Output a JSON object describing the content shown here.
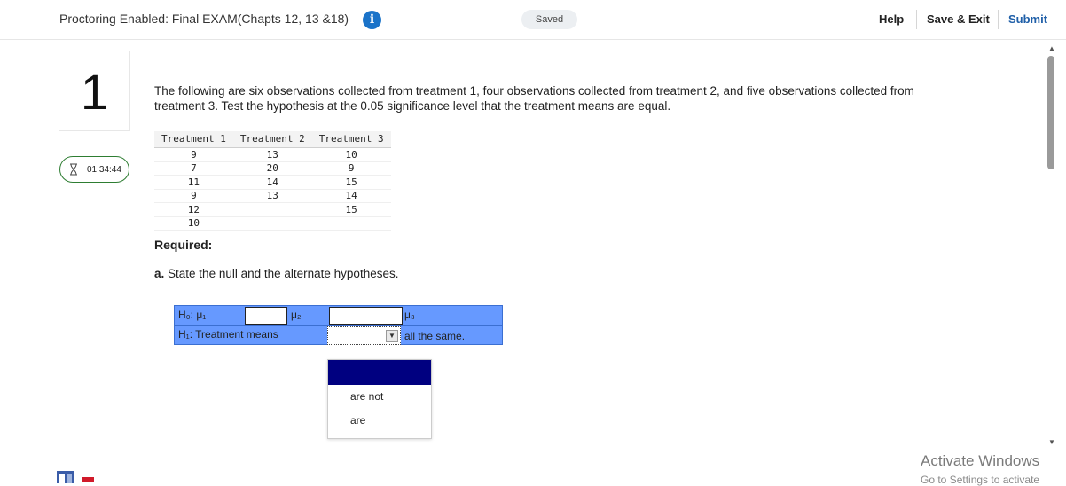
{
  "header": {
    "exam_title": "Proctoring Enabled: Final EXAM(Chapts 12, 13 &18)",
    "saved_label": "Saved",
    "help_label": "Help",
    "save_exit_label": "Save & Exit",
    "submit_label": "Submit"
  },
  "question": {
    "number": "1",
    "timer": "01:34:44",
    "text": "The following are six observations collected from treatment 1, four observations collected from treatment 2, and five observations collected from treatment 3. Test the hypothesis at the 0.05 significance level that the treatment means are equal."
  },
  "table": {
    "headers": [
      "Treatment 1",
      "Treatment 2",
      "Treatment 3"
    ],
    "rows": [
      [
        "9",
        "13",
        "10"
      ],
      [
        "7",
        "20",
        "9"
      ],
      [
        "11",
        "14",
        "15"
      ],
      [
        "9",
        "13",
        "14"
      ],
      [
        "12",
        "",
        "15"
      ],
      [
        "10",
        "",
        ""
      ]
    ]
  },
  "required": {
    "label": "Required:",
    "part_a_letter": "a.",
    "part_a_text": "State the null and the alternate hypotheses."
  },
  "hypotheses": {
    "h0_label": "H₀: μ₁",
    "mu2": "μ₂",
    "mu3": "μ₃",
    "h1_label": "H₁: Treatment means",
    "h1_tail": "all the same.",
    "input1_value": "",
    "input2_value": "",
    "select_value": ""
  },
  "dropdown": {
    "options": [
      "are not",
      "are"
    ]
  },
  "watermark": {
    "line1": "Activate Windows",
    "line2": "Go to Settings to activate"
  },
  "colors": {
    "hyp_bg": "#6699ff",
    "dropdown_highlight": "#000080",
    "submit": "#1f5fa8",
    "info_icon": "#1a73c9",
    "timer_border": "#2e7d32"
  }
}
